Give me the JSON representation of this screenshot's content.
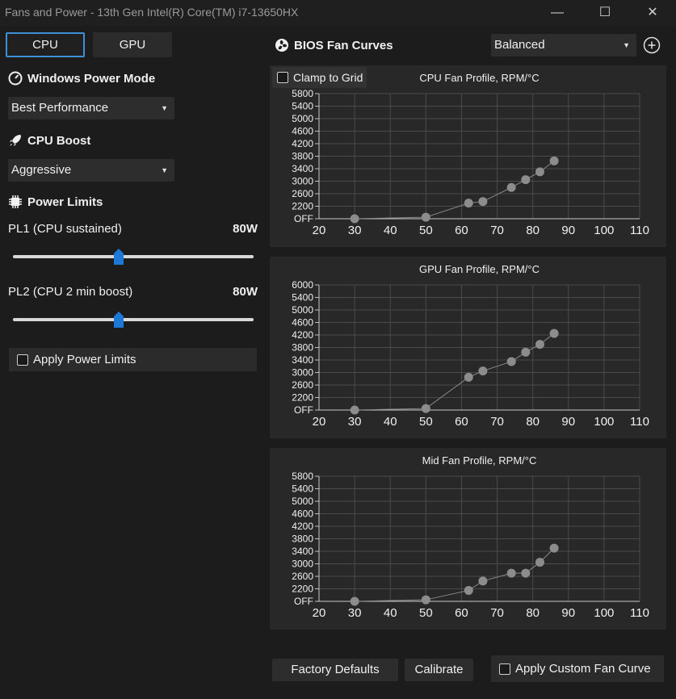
{
  "window": {
    "title": "Fans and Power - 13th Gen Intel(R) Core(TM) i7-13650HX",
    "min": "—",
    "max": "☐",
    "close": "✕"
  },
  "tabs": [
    {
      "label": "CPU"
    },
    {
      "label": "GPU"
    }
  ],
  "power_mode": {
    "title": "Windows Power Mode",
    "value": "Best Performance"
  },
  "cpu_boost": {
    "title": "CPU Boost",
    "value": "Aggressive"
  },
  "power_limits": {
    "title": "Power Limits",
    "pl1": {
      "label": "PL1 (CPU sustained)",
      "value": "80W",
      "level": 0.44
    },
    "pl2": {
      "label": "PL2 (CPU 2 min boost)",
      "value": "80W",
      "level": 0.44
    },
    "apply_label": "Apply Power Limits"
  },
  "fan_curves": {
    "title": "BIOS Fan Curves",
    "preset": "Balanced",
    "clamp_label": "Clamp to Grid",
    "factory_label": "Factory Defaults",
    "calibrate_label": "Calibrate",
    "apply_label": "Apply Custom Fan Curve"
  },
  "chart_data": [
    {
      "type": "line",
      "title": "CPU Fan Profile, RPM/°C",
      "xlim": [
        20,
        110
      ],
      "ylim": [
        1800,
        5800
      ],
      "x_ticks": [
        20,
        30,
        40,
        50,
        60,
        70,
        80,
        90,
        100,
        110
      ],
      "y_ticks": [
        1800,
        2200,
        2600,
        3000,
        3400,
        3800,
        4200,
        4600,
        5000,
        5400,
        5800
      ],
      "y_tick_labels": [
        "OFF",
        "2200",
        "2600",
        "3000",
        "3400",
        "3800",
        "4200",
        "4600",
        "5000",
        "5400",
        "5800"
      ],
      "points": [
        [
          30,
          1800
        ],
        [
          50,
          1850
        ],
        [
          62,
          2300
        ],
        [
          66,
          2350
        ],
        [
          74,
          2800
        ],
        [
          78,
          3050
        ],
        [
          82,
          3300
        ],
        [
          86,
          3650
        ]
      ],
      "grid": true
    },
    {
      "type": "line",
      "title": "GPU Fan Profile, RPM/°C",
      "xlim": [
        20,
        110
      ],
      "ylim": [
        1800,
        6000
      ],
      "x_ticks": [
        20,
        30,
        40,
        50,
        60,
        70,
        80,
        90,
        100,
        110
      ],
      "y_ticks": [
        1800,
        2200,
        2600,
        3000,
        3400,
        3800,
        4200,
        4600,
        5000,
        5400,
        6000
      ],
      "y_tick_labels": [
        "OFF",
        "2200",
        "2600",
        "3000",
        "3400",
        "3800",
        "4200",
        "4600",
        "5000",
        "5400",
        "6000"
      ],
      "points": [
        [
          30,
          1800
        ],
        [
          50,
          1850
        ],
        [
          62,
          2850
        ],
        [
          66,
          3050
        ],
        [
          74,
          3350
        ],
        [
          78,
          3650
        ],
        [
          82,
          3900
        ],
        [
          86,
          4250
        ]
      ],
      "grid": true
    },
    {
      "type": "line",
      "title": "Mid Fan Profile, RPM/°C",
      "xlim": [
        20,
        110
      ],
      "ylim": [
        1800,
        5800
      ],
      "x_ticks": [
        20,
        30,
        40,
        50,
        60,
        70,
        80,
        90,
        100,
        110
      ],
      "y_ticks": [
        1800,
        2200,
        2600,
        3000,
        3400,
        3800,
        4200,
        4600,
        5000,
        5400,
        5800
      ],
      "y_tick_labels": [
        "OFF",
        "2200",
        "2600",
        "3000",
        "3400",
        "3800",
        "4200",
        "4600",
        "5000",
        "5400",
        "5800"
      ],
      "points": [
        [
          30,
          1800
        ],
        [
          50,
          1850
        ],
        [
          62,
          2150
        ],
        [
          66,
          2450
        ],
        [
          74,
          2700
        ],
        [
          78,
          2700
        ],
        [
          82,
          3050
        ],
        [
          86,
          3500
        ]
      ],
      "grid": true
    }
  ]
}
